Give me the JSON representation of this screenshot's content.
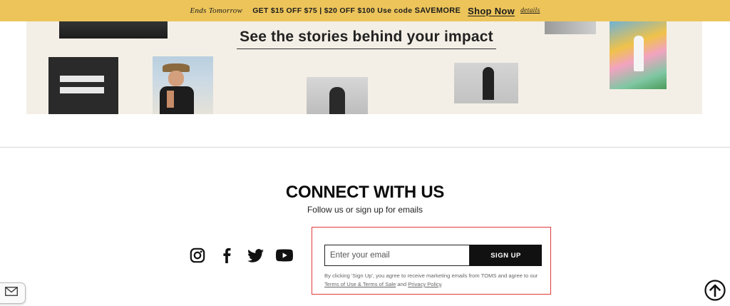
{
  "promo": {
    "ends": "Ends Tomorrow",
    "offer": "GET $15 OFF $75 | $20 OFF $100 Use code",
    "code": "SAVEMORE",
    "shop_now": "Shop Now",
    "details": "details",
    "background": "#ecc45a"
  },
  "impact": {
    "title": "See the stories behind your impact",
    "background": "#f4efe6"
  },
  "connect": {
    "title": "CONNECT WITH US",
    "subtitle": "Follow us or sign up for emails",
    "social_icons": [
      "instagram-icon",
      "facebook-icon",
      "twitter-icon",
      "youtube-icon"
    ],
    "email_placeholder": "Enter your email",
    "email_value": "",
    "signup_label": "SIGN UP",
    "legal_prefix": "By clicking 'Sign Up', you agree to receive marketing emails from TOMS and agree to our",
    "terms_link": "Terms of Use & Terms of Sale",
    "and": "and",
    "privacy_link": "Privacy Policy",
    "period": ".",
    "highlight_color": "#e23b3b"
  },
  "widgets": {
    "email_icon": "envelope-icon",
    "scroll_icon": "arrow-up-circle-icon"
  }
}
